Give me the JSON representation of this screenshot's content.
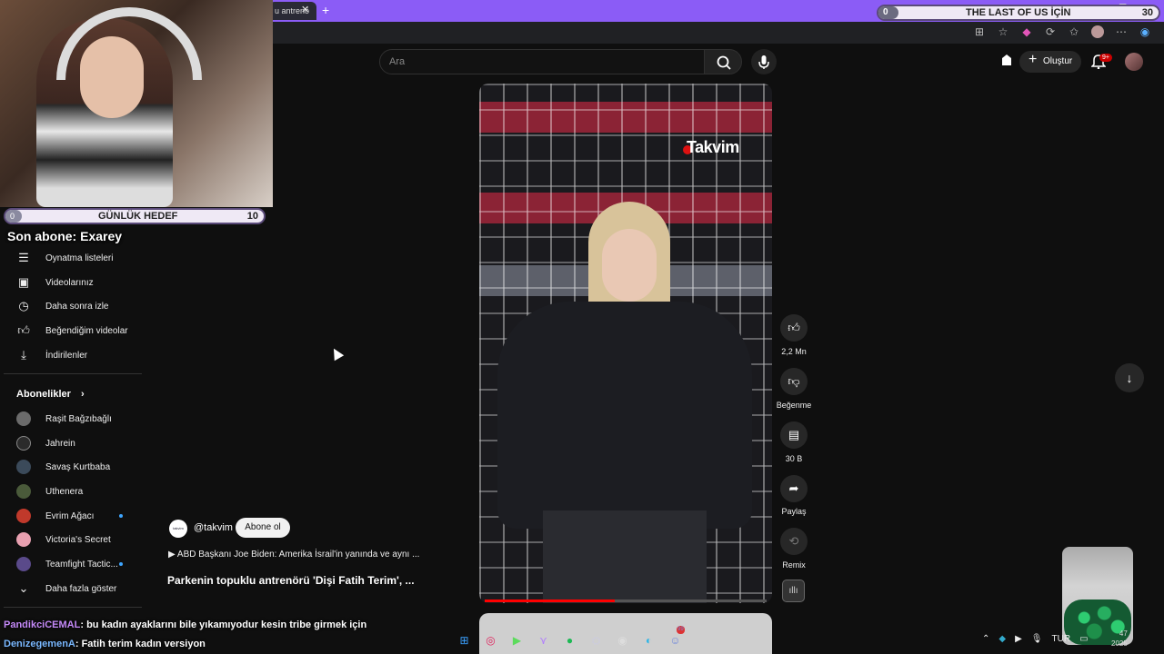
{
  "browser": {
    "tab_title": "u antrenö",
    "new_tab_icon": "plus-icon",
    "address_icons": [
      "extensions-icon",
      "star-icon",
      "extension-icon",
      "sync-icon",
      "favorites-icon",
      "profile-icon",
      "more-icon",
      "copilot-icon"
    ]
  },
  "goal_bar_top": {
    "current": "0",
    "title": "THE LAST OF US İÇİN",
    "target": "30",
    "progress": 0
  },
  "goal_bar_daily": {
    "current": "0",
    "title": "GÜNLÜK HEDEF",
    "target": "10",
    "progress": 0
  },
  "last_subscriber": "Son abone: Exarey",
  "youtube_header": {
    "search_placeholder": "Ara",
    "create_label": "Oluştur",
    "notifications_badge": "9+"
  },
  "sidebar": {
    "you_items": [
      {
        "label": "Oynatma listeleri",
        "icon": "playlist-icon"
      },
      {
        "label": "Videolarınız",
        "icon": "video-icon"
      },
      {
        "label": "Daha sonra izle",
        "icon": "clock-icon"
      },
      {
        "label": "Beğendiğim videolar",
        "icon": "thumbs-up-icon"
      },
      {
        "label": "İndirilenler",
        "icon": "download-icon"
      }
    ],
    "subscriptions_title": "Abonelikler",
    "subscriptions": [
      {
        "label": "Raşit Bağzıbağlı",
        "color": "#6b6b6b",
        "new": false
      },
      {
        "label": "Jahrein",
        "color": "#2b2b2b",
        "new": false
      },
      {
        "label": "Savaş Kurtbaba",
        "color": "#3b4a5a",
        "new": false
      },
      {
        "label": "Uthenera",
        "color": "#4a5a3a",
        "new": false
      },
      {
        "label": "Evrim Ağacı",
        "color": "#c0392b",
        "new": true
      },
      {
        "label": "Victoria's Secret",
        "color": "#e8a0b0",
        "new": false
      },
      {
        "label": "Teamfight Tactic...",
        "color": "#5a4a8a",
        "new": true
      }
    ],
    "show_more": "Daha fazla göster"
  },
  "short": {
    "logo_text": "Takvim",
    "channel_handle": "@takvim",
    "channel_avatar_text": "takvim",
    "subscribe_label": "Abone ol",
    "description": "▶ ABD Başkanı Joe Biden: Amerika İsrail'in yanında ve aynı ...",
    "title": "Parkenin topuklu antrenörü 'Dişi Fatih Terim', ...",
    "progress": 0.46
  },
  "actions": {
    "like_count": "2,2 Mn",
    "dislike_label": "Beğenme",
    "comments_count": "30 B",
    "share_label": "Paylaş",
    "remix_label": "Remix"
  },
  "chat": [
    {
      "user": "PandikciCEMAL",
      "message": ": bu kadın ayaklarını bile yıkamıyodur kesin tribe girmek için"
    },
    {
      "user": "DenizegemenA",
      "message": ": Fatih terim kadın versiyon"
    }
  ],
  "taskbar": {
    "icons": [
      "windows-icon",
      "opera-gx-icon",
      "terminal-icon",
      "vs-icon",
      "spotify-icon",
      "steam-icon",
      "obs-icon",
      "edge-icon",
      "discord-icon"
    ],
    "discord_badge": "99",
    "language": "TUR",
    "time": "47",
    "date": "2025"
  }
}
